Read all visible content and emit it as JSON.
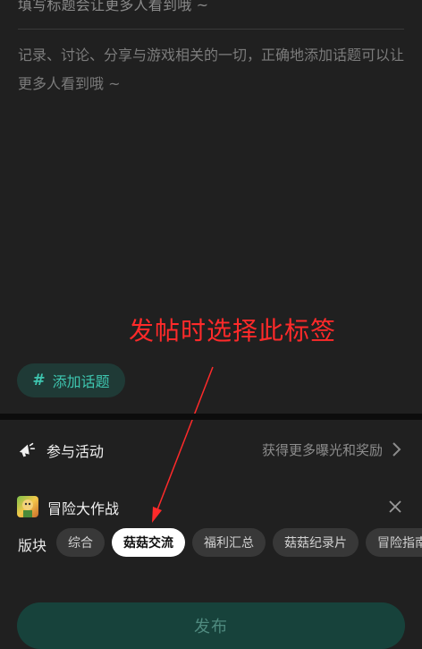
{
  "editor": {
    "title_placeholder": "填写标题会让更多人看到哦 ~",
    "content_placeholder": "记录、讨论、分享与游戏相关的一切，正确地添加话题可以让更多人看到哦 ~"
  },
  "annotation": {
    "text": "发帖时选择此标签",
    "color": "#ff2a2a"
  },
  "topic_button": {
    "hash": "#",
    "label": "添加话题",
    "color": "#3ec6b0"
  },
  "activity": {
    "icon": "megaphone-icon",
    "label": "参与活动",
    "description": "获得更多曝光和奖励"
  },
  "game": {
    "name": "冒险大作战"
  },
  "section": {
    "label": "版块",
    "chips": [
      {
        "label": "综合",
        "active": false
      },
      {
        "label": "菇菇交流",
        "active": true
      },
      {
        "label": "福利汇总",
        "active": false
      },
      {
        "label": "菇菇纪录片",
        "active": false
      },
      {
        "label": "冒险指南",
        "active": false
      }
    ]
  },
  "publish": {
    "label": "发布"
  }
}
